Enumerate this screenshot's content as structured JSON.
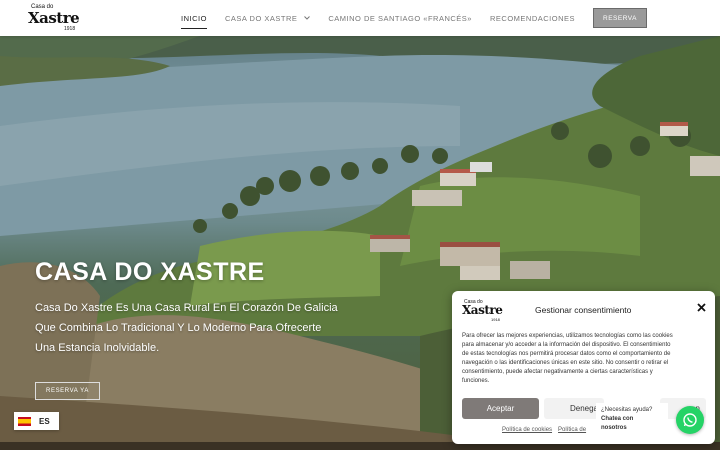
{
  "header": {
    "logo": {
      "small": "Casa do",
      "big": "Xastre",
      "year": "1918"
    },
    "nav": [
      {
        "label": "INICIO"
      },
      {
        "label": "CASA DO XASTRE"
      },
      {
        "label": "CAMINO DE SANTIAGO «FRANCÉS»"
      },
      {
        "label": "RECOMENDACIONES"
      }
    ],
    "reserve_label": "RESERVA"
  },
  "hero": {
    "title": "CASA DO XASTRE",
    "description_lines": [
      "Casa Do Xastre Es Una Casa Rural En El Corazón De Galicia",
      "Que Combina Lo Tradicional Y Lo Moderno Para Ofrecerte",
      "Una Estancia Inolvidable."
    ],
    "cta_label": "RESERVA YA"
  },
  "language": {
    "code": "ES"
  },
  "consent": {
    "logo": {
      "small": "Casa do",
      "big": "Xastre",
      "year": "1918"
    },
    "title": "Gestionar consentimiento",
    "body_lines": [
      "Para ofrecer las mejores experiencias, utilizamos tecnologías como las cookies",
      "para almacenar y/o acceder a la información del dispositivo. El consentimiento",
      "de estas tecnologías nos permitirá procesar datos como el comportamiento de",
      "navegación o las identificaciones únicas en este sitio. No consentir o retirar el",
      "consentimiento, puede afectar negativamente a ciertas características y",
      "funciones."
    ],
    "accept_label": "Aceptar",
    "deny_label": "Denega",
    "prefs_label": "en",
    "links": [
      "Política de cookies",
      "Política de"
    ]
  },
  "whatsapp": {
    "question": "¿Necesitas ayuda?",
    "cta_line1": "Chatea con",
    "cta_line2": "nosotros"
  },
  "colors": {
    "reserve_button": "#9a9a9a",
    "accept_button": "#7f7a78",
    "whatsapp": "#25d366"
  },
  "icons": [
    "chevron-down-icon",
    "close-icon",
    "whatsapp-icon",
    "spain-flag-icon"
  ]
}
